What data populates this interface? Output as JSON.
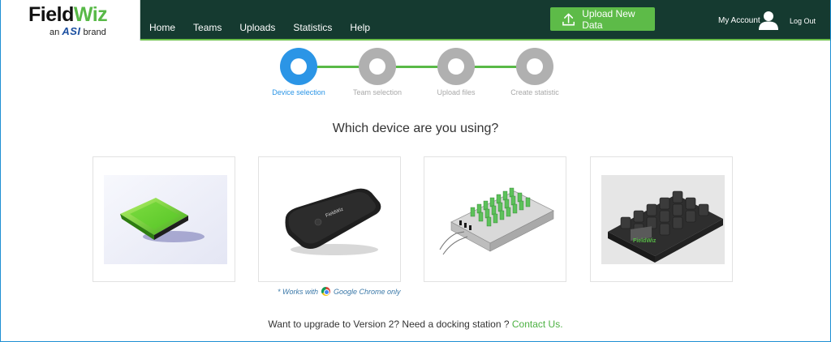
{
  "logo": {
    "field": "Field",
    "wiz": "Wiz",
    "an": "an",
    "asi": "ASI",
    "brand": "brand"
  },
  "nav": {
    "home": "Home",
    "teams": "Teams",
    "uploads": "Uploads",
    "statistics": "Statistics",
    "help": "Help"
  },
  "header": {
    "upload_button": "Upload New Data",
    "my_account": "My Account",
    "log_out": "Log Out"
  },
  "stepper": {
    "steps": [
      {
        "label": "Device selection",
        "active": true
      },
      {
        "label": "Team selection",
        "active": false
      },
      {
        "label": "Upload files",
        "active": false
      },
      {
        "label": "Create statistic",
        "active": false
      }
    ]
  },
  "main": {
    "question": "Which device are you using?",
    "chrome_note_prefix": "* Works with",
    "chrome_note_suffix": "Google Chrome only",
    "footer_text": "Want to upgrade to Version 2? Need a docking station ?",
    "contact_link": "Contact Us",
    "footer_period": "."
  },
  "devices": [
    {
      "name": "fieldwiz-v1-device"
    },
    {
      "name": "fieldwiz-v2-device"
    },
    {
      "name": "docking-station"
    },
    {
      "name": "charging-dock"
    }
  ],
  "colors": {
    "header_bg": "#153a30",
    "accent_green": "#5dbb48",
    "active_blue": "#2b95e6",
    "inactive_gray": "#b0b0b0"
  }
}
